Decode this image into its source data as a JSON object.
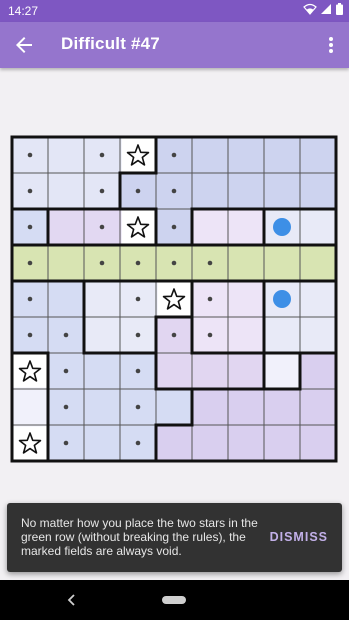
{
  "status_bar": {
    "time": "14:27",
    "icons": [
      "wifi-icon",
      "signal-icon",
      "battery-icon"
    ]
  },
  "app_bar": {
    "title": "Difficult #47",
    "back_icon": "arrow-left-icon",
    "menu_icon": "more-vert-icon"
  },
  "puzzle": {
    "size": 9,
    "colors": {
      "A": "#e3e6f6",
      "B": "#cdd3ef",
      "C": "#e2d8f2",
      "D": "#ede4f7",
      "E": "#d8e4b2",
      "F": "#d5dcf3",
      "G": "#e8eaf7",
      "H": "#d9cfef",
      "I": "#f1f1fb",
      "J": "#e1d6f1",
      "accent_marker": "#3d8fe6"
    },
    "regions": [
      "AAAABBBBB",
      "AAABBBBBB",
      "FCCCBDDGG",
      "EEEEEEEEE",
      "FFGGGDDGG",
      "FFGGJDDGG",
      "IFFFJJJIH",
      "IFFFFHHHH",
      "IFFFHHHHH"
    ],
    "stars": [
      [
        0,
        3
      ],
      [
        2,
        3
      ],
      [
        4,
        4
      ],
      [
        6,
        0
      ],
      [
        8,
        0
      ]
    ],
    "dots": [
      [
        0,
        0
      ],
      [
        0,
        2
      ],
      [
        0,
        4
      ],
      [
        1,
        0
      ],
      [
        1,
        2
      ],
      [
        1,
        3
      ],
      [
        1,
        4
      ],
      [
        2,
        0
      ],
      [
        2,
        2
      ],
      [
        2,
        4
      ],
      [
        3,
        0
      ],
      [
        3,
        2
      ],
      [
        3,
        3
      ],
      [
        3,
        4
      ],
      [
        3,
        5
      ],
      [
        4,
        0
      ],
      [
        4,
        3
      ],
      [
        4,
        5
      ],
      [
        5,
        0
      ],
      [
        5,
        1
      ],
      [
        5,
        3
      ],
      [
        5,
        4
      ],
      [
        5,
        5
      ],
      [
        6,
        1
      ],
      [
        6,
        3
      ],
      [
        7,
        1
      ],
      [
        7,
        3
      ],
      [
        8,
        1
      ],
      [
        8,
        3
      ]
    ],
    "markers": [
      [
        2,
        7
      ],
      [
        4,
        7
      ]
    ]
  },
  "snackbar": {
    "message": "No matter how you place the two stars in the green row (without breaking the rules), the marked fields are always void.",
    "action": "DISMISS"
  },
  "nav_bar": {
    "back_icon": "nav-back-icon",
    "home_icon": "nav-home-icon"
  }
}
